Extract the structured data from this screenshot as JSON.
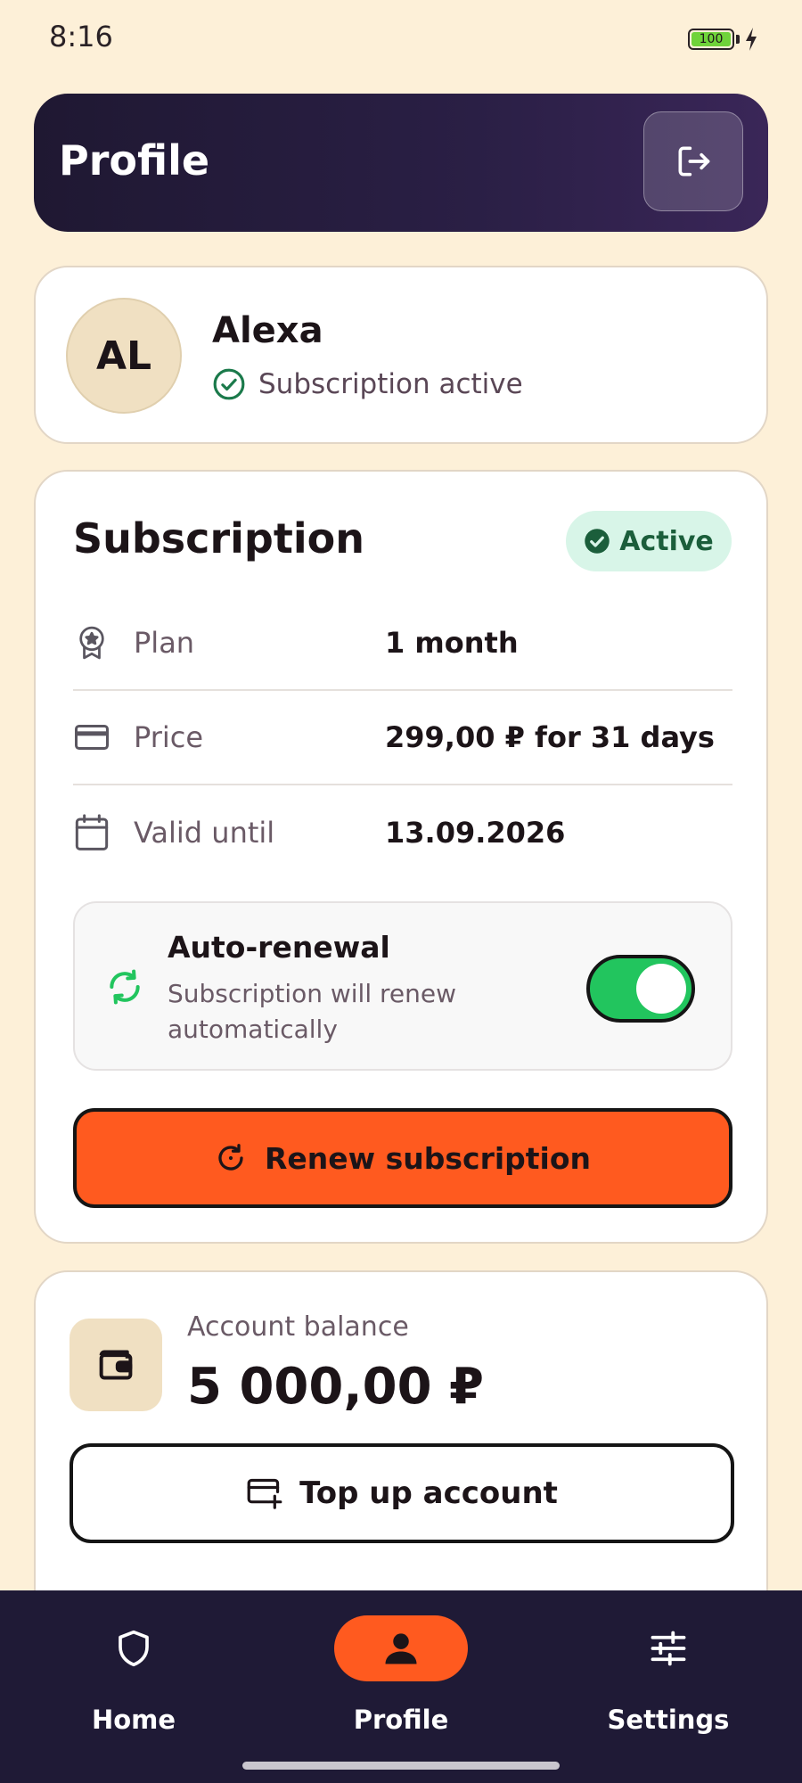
{
  "status_bar": {
    "time": "8:16",
    "battery": "100"
  },
  "header": {
    "title": "Profile",
    "logout_icon": "logout-icon"
  },
  "user": {
    "initials": "AL",
    "name": "Alexa",
    "status": "Subscription active"
  },
  "subscription": {
    "title": "Subscription",
    "badge": "Active",
    "rows": [
      {
        "icon": "award-icon",
        "label": "Plan",
        "value": "1 month"
      },
      {
        "icon": "credit-card-icon",
        "label": "Price",
        "value": "299,00 ₽ for 31 days"
      },
      {
        "icon": "calendar-icon",
        "label": "Valid until",
        "value": "13.09.2026"
      }
    ],
    "auto_renewal": {
      "title": "Auto-renewal",
      "description": "Subscription will renew automatically",
      "enabled": true
    },
    "renew_button": "Renew subscription"
  },
  "balance": {
    "label": "Account balance",
    "value": "5 000,00 ₽",
    "topup_button": "Top up account"
  },
  "nav": {
    "items": [
      {
        "label": "Home",
        "icon": "shield-icon",
        "active": false
      },
      {
        "label": "Profile",
        "icon": "person-icon",
        "active": true
      },
      {
        "label": "Settings",
        "icon": "sliders-icon",
        "active": false
      }
    ]
  },
  "colors": {
    "accent": "#ff5a1f",
    "success": "#22c55e",
    "nav_bg": "#1f1a36",
    "page_bg": "#fdf0d8"
  }
}
